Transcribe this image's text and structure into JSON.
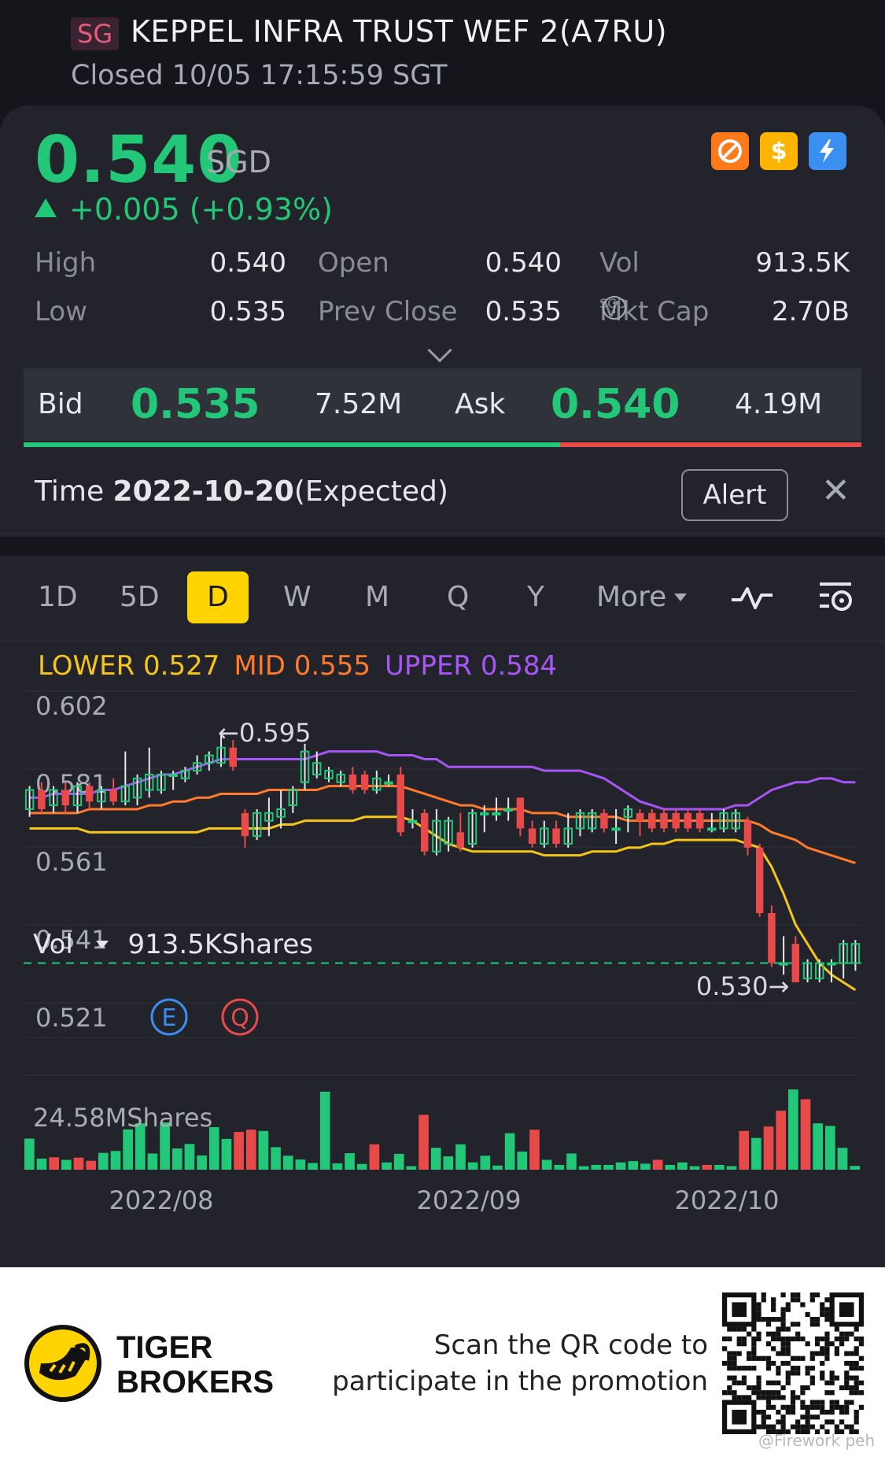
{
  "header": {
    "market_badge": "SG",
    "title": "KEPPEL INFRA TRUST WEF 2(A7RU)",
    "status": "Closed 10/05 17:15:59 SGT"
  },
  "quote": {
    "price": "0.540",
    "currency": "SGD",
    "change": "+0.005 (+0.93%)",
    "high_label": "High",
    "high": "0.540",
    "low_label": "Low",
    "low": "0.535",
    "open_label": "Open",
    "open": "0.540",
    "prev_close_label": "Prev Close",
    "prev_close": "0.535",
    "vol_label": "Vol",
    "vol": "913.5K",
    "mkt_cap_label": "Mkt Cap",
    "mkt_cap_currency": "SGD",
    "mkt_cap": "2.70B"
  },
  "bid_ask": {
    "bid_label": "Bid",
    "bid_price": "0.535",
    "bid_vol": "7.52M",
    "ask_label": "Ask",
    "ask_price": "0.540",
    "ask_vol": "4.19M",
    "bid_ratio": 0.64
  },
  "time_row": {
    "label": "Time ",
    "date": "2022-10-20",
    "suffix": "(Expected)",
    "alert_label": "Alert"
  },
  "period_tabs": [
    "1D",
    "5D",
    "D",
    "W",
    "M",
    "Q",
    "Y"
  ],
  "active_tab": "D",
  "more_label": "More",
  "boll": {
    "lower": "LOWER 0.527",
    "mid": "MID 0.555",
    "upper": "UPPER 0.584"
  },
  "colors": {
    "up": "#22c878",
    "down": "#e84a4a",
    "lower": "#f5c518",
    "mid": "#ff7a2a",
    "upper": "#a855f7",
    "accent": "#ffd400"
  },
  "chart_data": {
    "type": "candlestick",
    "y_axis_labels": [
      "0.602",
      "0.581",
      "0.561",
      "0.541",
      "0.521"
    ],
    "ylim": [
      0.521,
      0.602
    ],
    "annotations": {
      "high": "←0.595",
      "low": "0.530→"
    },
    "event_markers": [
      "E",
      "Q"
    ],
    "reference_line": 0.535,
    "x_axis_labels": [
      "2022/08",
      "2022/09",
      "2022/10"
    ],
    "candles": [
      [
        0.575,
        0.58,
        0.573,
        0.581
      ],
      [
        0.58,
        0.575,
        0.574,
        0.582
      ],
      [
        0.576,
        0.58,
        0.574,
        0.581
      ],
      [
        0.58,
        0.576,
        0.574,
        0.582
      ],
      [
        0.576,
        0.581,
        0.574,
        0.582
      ],
      [
        0.581,
        0.577,
        0.575,
        0.582
      ],
      [
        0.577,
        0.58,
        0.575,
        0.581
      ],
      [
        0.58,
        0.577,
        0.576,
        0.583
      ],
      [
        0.577,
        0.581,
        0.576,
        0.59
      ],
      [
        0.578,
        0.583,
        0.576,
        0.584
      ],
      [
        0.58,
        0.584,
        0.578,
        0.591
      ],
      [
        0.58,
        0.584,
        0.579,
        0.585
      ],
      [
        0.584,
        0.584,
        0.58,
        0.585
      ],
      [
        0.583,
        0.585,
        0.582,
        0.586
      ],
      [
        0.585,
        0.587,
        0.584,
        0.589
      ],
      [
        0.587,
        0.589,
        0.585,
        0.59
      ],
      [
        0.587,
        0.591,
        0.586,
        0.595
      ],
      [
        0.591,
        0.586,
        0.585,
        0.593
      ],
      [
        0.574,
        0.568,
        0.565,
        0.575
      ],
      [
        0.568,
        0.574,
        0.567,
        0.575
      ],
      [
        0.572,
        0.574,
        0.568,
        0.578
      ],
      [
        0.573,
        0.575,
        0.57,
        0.58
      ],
      [
        0.576,
        0.58,
        0.574,
        0.581
      ],
      [
        0.582,
        0.59,
        0.58,
        0.592
      ],
      [
        0.584,
        0.587,
        0.583,
        0.59
      ],
      [
        0.583,
        0.585,
        0.582,
        0.586
      ],
      [
        0.582,
        0.584,
        0.581,
        0.585
      ],
      [
        0.584,
        0.58,
        0.579,
        0.586
      ],
      [
        0.584,
        0.58,
        0.579,
        0.585
      ],
      [
        0.58,
        0.583,
        0.579,
        0.585
      ],
      [
        0.582,
        0.582,
        0.581,
        0.584
      ],
      [
        0.584,
        0.569,
        0.568,
        0.586
      ],
      [
        0.572,
        0.572,
        0.57,
        0.575
      ],
      [
        0.574,
        0.564,
        0.563,
        0.575
      ],
      [
        0.564,
        0.572,
        0.563,
        0.575
      ],
      [
        0.566,
        0.572,
        0.564,
        0.573
      ],
      [
        0.569,
        0.565,
        0.564,
        0.574
      ],
      [
        0.566,
        0.574,
        0.565,
        0.575
      ],
      [
        0.574,
        0.574,
        0.569,
        0.576
      ],
      [
        0.574,
        0.574,
        0.572,
        0.578
      ],
      [
        0.575,
        0.575,
        0.572,
        0.578
      ],
      [
        0.578,
        0.57,
        0.568,
        0.578
      ],
      [
        0.57,
        0.566,
        0.565,
        0.572
      ],
      [
        0.566,
        0.57,
        0.565,
        0.572
      ],
      [
        0.57,
        0.566,
        0.565,
        0.572
      ],
      [
        0.566,
        0.57,
        0.565,
        0.574
      ],
      [
        0.57,
        0.574,
        0.568,
        0.575
      ],
      [
        0.57,
        0.574,
        0.569,
        0.575
      ],
      [
        0.574,
        0.57,
        0.569,
        0.575
      ],
      [
        0.57,
        0.57,
        0.566,
        0.575
      ],
      [
        0.573,
        0.575,
        0.569,
        0.576
      ],
      [
        0.574,
        0.572,
        0.568,
        0.575
      ],
      [
        0.574,
        0.57,
        0.569,
        0.575
      ],
      [
        0.574,
        0.57,
        0.569,
        0.575
      ],
      [
        0.574,
        0.57,
        0.569,
        0.575
      ],
      [
        0.574,
        0.57,
        0.569,
        0.575
      ],
      [
        0.574,
        0.57,
        0.569,
        0.575
      ],
      [
        0.57,
        0.57,
        0.569,
        0.574
      ],
      [
        0.57,
        0.574,
        0.569,
        0.575
      ],
      [
        0.57,
        0.574,
        0.569,
        0.575
      ],
      [
        0.572,
        0.565,
        0.563,
        0.573
      ],
      [
        0.565,
        0.548,
        0.547,
        0.566
      ],
      [
        0.548,
        0.535,
        0.534,
        0.55
      ],
      [
        0.535,
        0.535,
        0.532,
        0.542
      ],
      [
        0.54,
        0.53,
        0.53,
        0.542
      ],
      [
        0.531,
        0.535,
        0.53,
        0.536
      ],
      [
        0.531,
        0.535,
        0.53,
        0.536
      ],
      [
        0.535,
        0.535,
        0.53,
        0.536
      ],
      [
        0.535,
        0.54,
        0.531,
        0.541
      ],
      [
        0.535,
        0.54,
        0.533,
        0.541
      ]
    ],
    "upper_band": [
      0.578,
      0.578,
      0.579,
      0.579,
      0.579,
      0.579,
      0.58,
      0.58,
      0.581,
      0.582,
      0.583,
      0.584,
      0.584,
      0.585,
      0.586,
      0.587,
      0.588,
      0.588,
      0.588,
      0.588,
      0.588,
      0.588,
      0.588,
      0.588,
      0.589,
      0.59,
      0.59,
      0.59,
      0.59,
      0.59,
      0.589,
      0.589,
      0.589,
      0.588,
      0.588,
      0.586,
      0.586,
      0.586,
      0.586,
      0.586,
      0.586,
      0.586,
      0.586,
      0.585,
      0.585,
      0.585,
      0.585,
      0.584,
      0.583,
      0.581,
      0.579,
      0.577,
      0.576,
      0.575,
      0.575,
      0.575,
      0.575,
      0.575,
      0.575,
      0.576,
      0.576,
      0.578,
      0.58,
      0.581,
      0.582,
      0.582,
      0.583,
      0.583,
      0.582,
      0.582
    ],
    "mid_band": [
      0.574,
      0.574,
      0.574,
      0.574,
      0.574,
      0.575,
      0.575,
      0.575,
      0.575,
      0.575,
      0.576,
      0.576,
      0.577,
      0.577,
      0.578,
      0.578,
      0.579,
      0.579,
      0.579,
      0.579,
      0.58,
      0.58,
      0.58,
      0.58,
      0.58,
      0.581,
      0.581,
      0.581,
      0.581,
      0.581,
      0.581,
      0.581,
      0.58,
      0.579,
      0.578,
      0.577,
      0.576,
      0.576,
      0.575,
      0.575,
      0.575,
      0.575,
      0.574,
      0.574,
      0.574,
      0.573,
      0.573,
      0.573,
      0.573,
      0.573,
      0.572,
      0.572,
      0.572,
      0.572,
      0.572,
      0.572,
      0.572,
      0.572,
      0.572,
      0.572,
      0.572,
      0.571,
      0.569,
      0.568,
      0.567,
      0.565,
      0.564,
      0.563,
      0.562,
      0.561
    ],
    "lower_band": [
      0.57,
      0.57,
      0.57,
      0.57,
      0.57,
      0.569,
      0.569,
      0.569,
      0.569,
      0.569,
      0.569,
      0.569,
      0.569,
      0.569,
      0.569,
      0.57,
      0.57,
      0.57,
      0.57,
      0.57,
      0.57,
      0.571,
      0.571,
      0.572,
      0.572,
      0.572,
      0.572,
      0.572,
      0.573,
      0.573,
      0.573,
      0.573,
      0.572,
      0.57,
      0.568,
      0.566,
      0.565,
      0.564,
      0.564,
      0.564,
      0.564,
      0.564,
      0.564,
      0.563,
      0.563,
      0.563,
      0.563,
      0.564,
      0.564,
      0.564,
      0.565,
      0.565,
      0.566,
      0.566,
      0.567,
      0.567,
      0.567,
      0.567,
      0.567,
      0.567,
      0.566,
      0.565,
      0.56,
      0.553,
      0.545,
      0.54,
      0.535,
      0.532,
      0.53,
      0.528
    ],
    "volume_label": "Vol",
    "volume_value": "913.5KShares",
    "volume_max_label": "24.58MShares",
    "volumes": [
      [
        9.8,
        "u"
      ],
      [
        3.5,
        "u"
      ],
      [
        3.9,
        "d"
      ],
      [
        3.1,
        "u"
      ],
      [
        3.8,
        "d"
      ],
      [
        2.8,
        "d"
      ],
      [
        5.3,
        "u"
      ],
      [
        5.9,
        "u"
      ],
      [
        12.7,
        "u"
      ],
      [
        14.6,
        "u"
      ],
      [
        5.1,
        "u"
      ],
      [
        14.9,
        "u"
      ],
      [
        6.7,
        "u"
      ],
      [
        8.1,
        "u"
      ],
      [
        4.5,
        "u"
      ],
      [
        13.4,
        "u"
      ],
      [
        9.7,
        "u"
      ],
      [
        11.9,
        "d"
      ],
      [
        12.6,
        "d"
      ],
      [
        12.2,
        "u"
      ],
      [
        7.1,
        "u"
      ],
      [
        4.4,
        "u"
      ],
      [
        3.2,
        "u"
      ],
      [
        2.1,
        "u"
      ],
      [
        24.6,
        "u"
      ],
      [
        2.0,
        "u"
      ],
      [
        5.2,
        "u"
      ],
      [
        1.8,
        "u"
      ],
      [
        8.0,
        "d"
      ],
      [
        2.3,
        "u"
      ],
      [
        5.0,
        "u"
      ],
      [
        1.1,
        "u"
      ],
      [
        17.3,
        "d"
      ],
      [
        6.9,
        "u"
      ],
      [
        4.2,
        "u"
      ],
      [
        8.0,
        "u"
      ],
      [
        2.3,
        "u"
      ],
      [
        4.4,
        "u"
      ],
      [
        1.3,
        "u"
      ],
      [
        11.5,
        "u"
      ],
      [
        5.7,
        "u"
      ],
      [
        12.6,
        "d"
      ],
      [
        3.1,
        "u"
      ],
      [
        1.5,
        "u"
      ],
      [
        5.1,
        "u"
      ],
      [
        1.1,
        "u"
      ],
      [
        1.5,
        "u"
      ],
      [
        1.5,
        "u"
      ],
      [
        2.3,
        "u"
      ],
      [
        2.7,
        "u"
      ],
      [
        1.9,
        "u"
      ],
      [
        3.1,
        "d"
      ],
      [
        1.5,
        "u"
      ],
      [
        2.3,
        "u"
      ],
      [
        1.1,
        "u"
      ],
      [
        1.5,
        "d"
      ],
      [
        1.5,
        "u"
      ],
      [
        1.1,
        "u"
      ],
      [
        12.2,
        "d"
      ],
      [
        10.0,
        "u"
      ],
      [
        13.6,
        "d"
      ],
      [
        18.6,
        "d"
      ],
      [
        25.3,
        "u"
      ],
      [
        22.2,
        "d"
      ],
      [
        14.6,
        "u"
      ],
      [
        13.8,
        "u"
      ],
      [
        6.9,
        "u"
      ],
      [
        1.2,
        "u"
      ]
    ]
  },
  "footer": {
    "brand_line1": "TIGER",
    "brand_line2": "BROKERS",
    "promo_line1": "Scan the QR code to",
    "promo_line2": "participate in the promotion",
    "watermark": "@Firework peh"
  }
}
